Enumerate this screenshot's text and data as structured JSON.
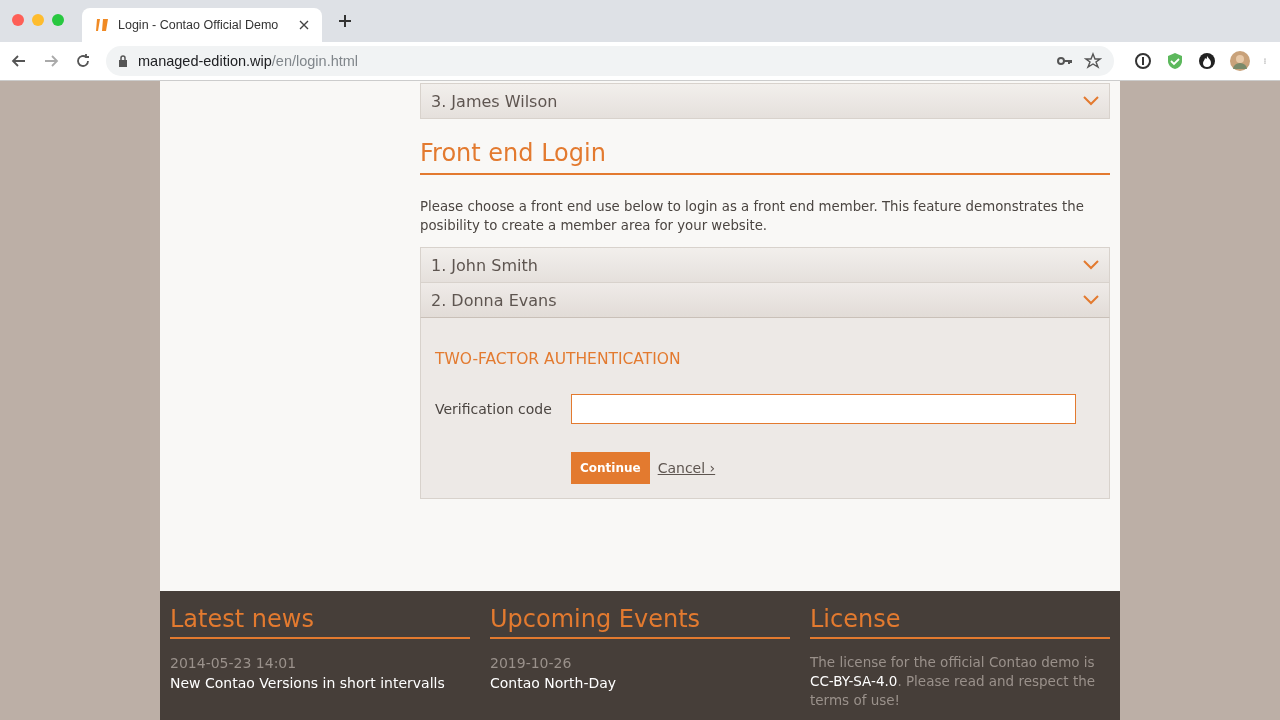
{
  "browser": {
    "tab_title": "Login - Contao Official Demo",
    "url_host": "managed-edition.wip",
    "url_path": "/en/login.html"
  },
  "top_accordion": [
    {
      "label": "3. James Wilson",
      "expanded": false
    }
  ],
  "login": {
    "heading": "Front end Login",
    "intro": "Please choose a front end use below to login as a front end member. This feature demonstrates the posibility to create a member area for your website.",
    "members": [
      {
        "label": "1. John Smith",
        "expanded": false
      },
      {
        "label": "2. Donna Evans",
        "expanded": true
      }
    ],
    "two_factor": {
      "heading": "TWO-FACTOR AUTHENTICATION",
      "field_label": "Verification code",
      "submit": "Continue",
      "cancel": "Cancel ›"
    }
  },
  "footer": {
    "news": {
      "heading": "Latest news",
      "date": "2014-05-23 14:01",
      "title": "New Contao Versions in short intervalls"
    },
    "events": {
      "heading": "Upcoming Events",
      "date": "2019-10-26",
      "title": "Contao North-Day"
    },
    "license": {
      "heading": "License",
      "before": "The license for the official Contao demo is",
      "link": "CC-BY-SA-4.0",
      "after": ". Please read and respect the terms of use!"
    }
  }
}
